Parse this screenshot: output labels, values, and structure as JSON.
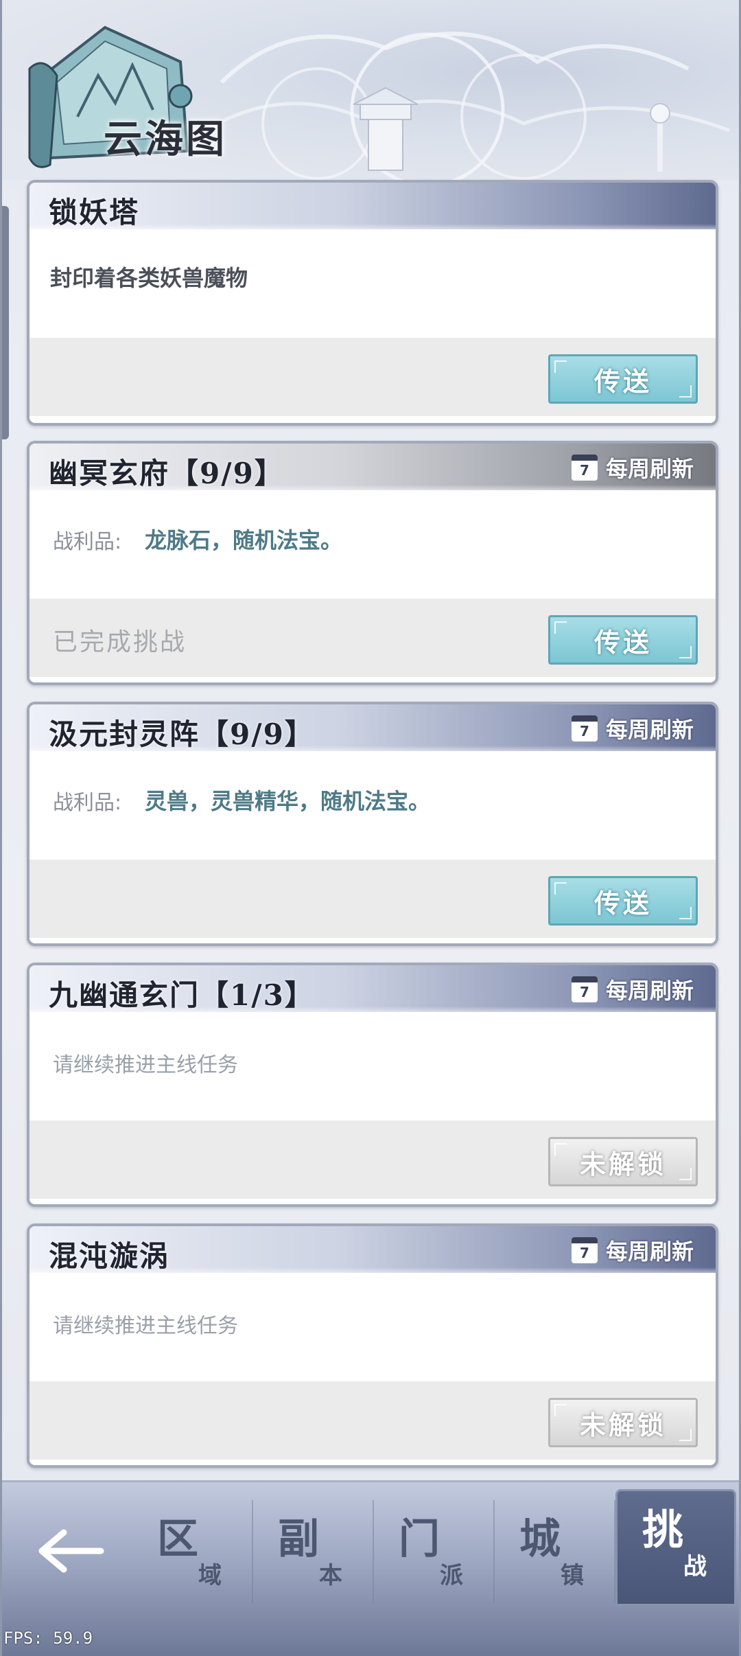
{
  "header": {
    "title": "云海图"
  },
  "cards": [
    {
      "title": "锁妖塔",
      "refresh": null,
      "desc": "封印着各类妖兽魔物",
      "status": "",
      "button": "传送"
    },
    {
      "title": "幽冥玄府【9/9】",
      "refresh": "每周刷新",
      "calendar_day": "7",
      "loot_label": "战利品:",
      "loot_value": "龙脉石，随机法宝。",
      "status": "已完成挑战",
      "button": "传送"
    },
    {
      "title": "汲元封灵阵【9/9】",
      "refresh": "每周刷新",
      "calendar_day": "7",
      "loot_label": "战利品:",
      "loot_value": "灵兽，灵兽精华，随机法宝。",
      "status": "",
      "button": "传送"
    },
    {
      "title": "九幽通玄门【1/3】",
      "refresh": "每周刷新",
      "calendar_day": "7",
      "hint": "请继续推进主线任务",
      "status": "",
      "button": "未解锁"
    },
    {
      "title": "混沌漩涡",
      "refresh": "每周刷新",
      "calendar_day": "7",
      "hint": "请继续推进主线任务",
      "status": "",
      "button": "未解锁"
    }
  ],
  "nav": {
    "tabs": [
      {
        "big": "区",
        "small": "域"
      },
      {
        "big": "副",
        "small": "本"
      },
      {
        "big": "门",
        "small": "派"
      },
      {
        "big": "城",
        "small": "镇"
      },
      {
        "big": "挑",
        "small": "战"
      }
    ],
    "active_index": 4
  },
  "fps": "FPS: 59.9",
  "colors": {
    "accent_teal": "#7cc6d3",
    "header_navy": "#5f6a90",
    "locked_gray": "#d6d6d6"
  }
}
